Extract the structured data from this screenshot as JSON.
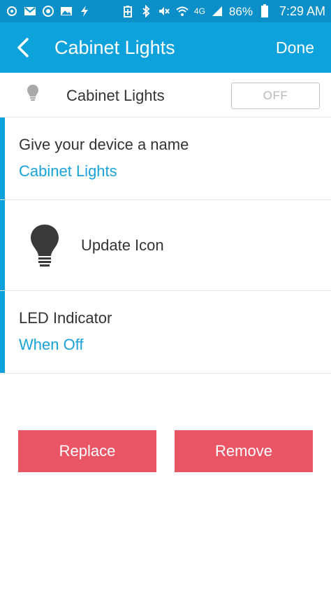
{
  "status_bar": {
    "battery_percent": "86%",
    "network": "4G",
    "time": "7:29 AM",
    "left_icons": [
      "settings-gear-icon",
      "gmail-icon",
      "circle-app-icon",
      "gallery-icon",
      "flash-icon"
    ],
    "right_icons": [
      "battery-saver-icon",
      "bluetooth-icon",
      "mute-icon",
      "wifi-icon",
      "signal-icon",
      "battery-icon"
    ]
  },
  "header": {
    "title": "Cabinet Lights",
    "done_label": "Done"
  },
  "device": {
    "name": "Cabinet Lights",
    "toggle_label": "OFF"
  },
  "settings": {
    "name_label": "Give your device a name",
    "name_value": "Cabinet Lights",
    "icon_label": "Update Icon",
    "led_label": "LED Indicator",
    "led_value": "When Off"
  },
  "actions": {
    "replace_label": "Replace",
    "remove_label": "Remove"
  },
  "colors": {
    "status_bar": "#0a8fc8",
    "app_bar": "#0ea2dc",
    "accent_text": "#1aa3db",
    "button": "#e95565"
  }
}
